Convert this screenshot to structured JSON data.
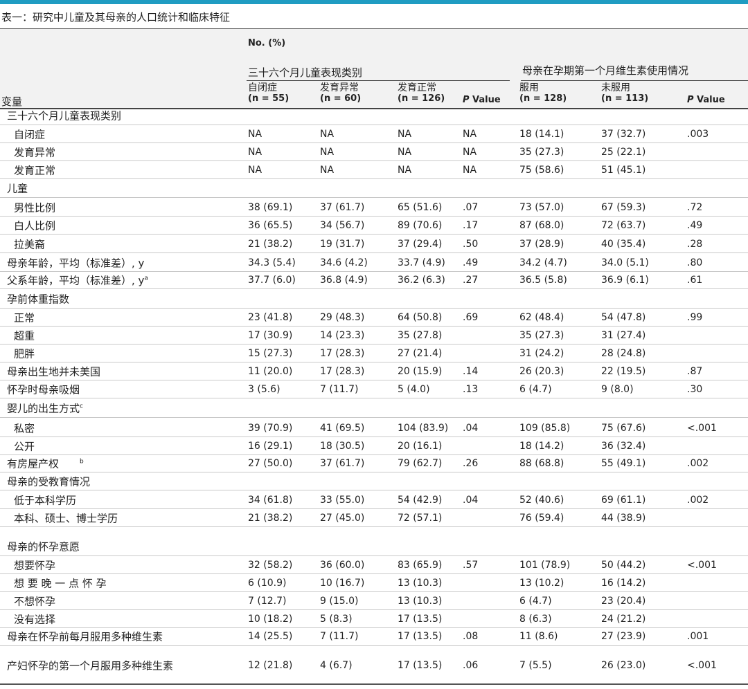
{
  "caption": "表一：研究中儿童及其母亲的人口统计和临床特征",
  "header": {
    "no_pct": "No. (%)",
    "group1": "三十六个月儿童表现类别",
    "group2": "母亲在孕期第一个月维生素使用情况",
    "variable": "变量",
    "columns": [
      {
        "name": "自闭症",
        "n": "(n = 55)"
      },
      {
        "name": "发育异常",
        "n": "(n = 60)"
      },
      {
        "name": "发育正常",
        "n": "(n = 126)"
      },
      {
        "name": "",
        "n": "Value",
        "p": "P"
      },
      {
        "name": "服用",
        "n": "(n = 128)"
      },
      {
        "name": "未服用",
        "n": "(n = 113)"
      },
      {
        "name": "",
        "n": "Value",
        "p": "P"
      }
    ]
  },
  "rows": [
    {
      "label": "三十六个月儿童表现类别",
      "cells": []
    },
    {
      "label": "自闭症",
      "cells": [
        "NA",
        "NA",
        "NA",
        "NA",
        "18 (14.1)",
        "37 (32.7)",
        ".003"
      ]
    },
    {
      "label": "发育异常",
      "cells": [
        "NA",
        "NA",
        "NA",
        "NA",
        "35 (27.3)",
        "25 (22.1)",
        ""
      ]
    },
    {
      "label": "发育正常",
      "cells": [
        "NA",
        "NA",
        "NA",
        "NA",
        "75 (58.6)",
        "51 (45.1)",
        ""
      ]
    },
    {
      "label": "儿童",
      "cells": []
    },
    {
      "label": "男性比例",
      "cells": [
        "38 (69.1)",
        "37 (61.7)",
        "65 (51.6)",
        ".07",
        "73 (57.0)",
        "67 (59.3)",
        ".72"
      ]
    },
    {
      "label": "白人比例",
      "cells": [
        "36 (65.5)",
        "34 (56.7)",
        "89 (70.6)",
        ".17",
        "87 (68.0)",
        "72 (63.7)",
        ".49"
      ]
    },
    {
      "label": "拉美裔",
      "cells": [
        "21 (38.2)",
        "19 (31.7)",
        "37 (29.4)",
        ".50",
        "37 (28.9)",
        "40 (35.4)",
        ".28"
      ]
    },
    {
      "label": "母亲年龄，平均（标准差）, y",
      "cells": [
        "34.3 (5.4)",
        "34.6 (4.2)",
        "33.7 (4.9)",
        ".49",
        "34.2 (4.7)",
        "34.0 (5.1)",
        ".80"
      ]
    },
    {
      "label": "父系年龄，平均（标准差）, y",
      "sup": "a",
      "cells": [
        "37.7 (6.0)",
        "36.8 (4.9)",
        "36.2 (6.3)",
        ".27",
        "36.5 (5.8)",
        "36.9 (6.1)",
        ".61"
      ]
    },
    {
      "label": "孕前体重指数",
      "cells": []
    },
    {
      "label": "正常",
      "cells": [
        "23 (41.8)",
        "29 (48.3)",
        "64 (50.8)",
        ".69",
        "62 (48.4)",
        "54 (47.8)",
        ".99"
      ]
    },
    {
      "label": "超重",
      "cells": [
        "17 (30.9)",
        "14 (23.3)",
        "35 (27.8)",
        "",
        "35 (27.3)",
        "31 (27.4)",
        ""
      ]
    },
    {
      "label": "肥胖",
      "cells": [
        "15 (27.3)",
        "17 (28.3)",
        "27 (21.4)",
        "",
        "31 (24.2)",
        "28 (24.8)",
        ""
      ]
    },
    {
      "label": "母亲出生地并未美国",
      "cells": [
        "11 (20.0)",
        "17 (28.3)",
        "20 (15.9)",
        ".14",
        "26 (20.3)",
        "22 (19.5)",
        ".87"
      ]
    },
    {
      "label": "怀孕时母亲吸烟",
      "cells": [
        "3 (5.6)",
        "7 (11.7)",
        "5 (4.0)",
        ".13",
        "6 (4.7)",
        "9 (8.0)",
        ".30"
      ]
    },
    {
      "label": "婴儿的出生方式",
      "sup": "c",
      "cells": []
    },
    {
      "label": "私密",
      "cells": [
        "39 (70.9)",
        "41 (69.5)",
        "104 (83.9)",
        ".04",
        "109 (85.8)",
        "75 (67.6)",
        "<.001"
      ]
    },
    {
      "label": "公开",
      "cells": [
        "16 (29.1)",
        "18 (30.5)",
        "20 (16.1)",
        "",
        "18 (14.2)",
        "36 (32.4)",
        ""
      ]
    },
    {
      "label": "有房屋产权",
      "sup": "b",
      "cells": [
        "27 (50.0)",
        "37 (61.7)",
        "79 (62.7)",
        ".26",
        "88 (68.8)",
        "55 (49.1)",
        ".002"
      ]
    },
    {
      "label": "母亲的受教育情况",
      "cells": []
    },
    {
      "label": "低于本科学历",
      "cells": [
        "34 (61.8)",
        "33 (55.0)",
        "54 (42.9)",
        ".04",
        "52 (40.6)",
        "69 (61.1)",
        ".002"
      ]
    },
    {
      "label": "本科、硕士、博士学历",
      "cells": [
        "21 (38.2)",
        "27 (45.0)",
        "72 (57.1)",
        "",
        "76 (59.4)",
        "44 (38.9)",
        ""
      ]
    },
    {
      "label": "母亲的怀孕意愿",
      "cells": []
    },
    {
      "label": "想要怀孕",
      "cells": [
        "32 (58.2)",
        "36 (60.0)",
        "83 (65.9)",
        ".57",
        "101 (78.9)",
        "50 (44.2)",
        "<.001"
      ]
    },
    {
      "label": "想 要 晚 一 点 怀 孕",
      "cells": [
        "6 (10.9)",
        "10 (16.7)",
        "13 (10.3)",
        "",
        "13 (10.2)",
        "16 (14.2)",
        ""
      ]
    },
    {
      "label": "不想怀孕",
      "cells": [
        "7 (12.7)",
        "9 (15.0)",
        "13 (10.3)",
        "",
        "6 (4.7)",
        "23 (20.4)",
        ""
      ]
    },
    {
      "label": "没有选择",
      "cells": [
        "10 (18.2)",
        "5 (8.3)",
        "17 (13.5)",
        "",
        "8 (6.3)",
        "24 (21.2)",
        ""
      ]
    },
    {
      "label": "母亲在怀孕前每月服用多种维生素",
      "cells": [
        "14 (25.5)",
        "7 (11.7)",
        "17 (13.5)",
        ".08",
        "11 (8.6)",
        "27 (23.9)",
        ".001"
      ]
    },
    {
      "label": "产妇怀孕的第一个月服用多种维生素",
      "cells": [
        "12 (21.8)",
        "4 (6.7)",
        "17 (13.5)",
        ".06",
        "7 (5.5)",
        "26 (23.0)",
        "<.001"
      ]
    }
  ],
  "colors": {
    "accent": "#1f9cc2",
    "header_bg": "#f2f2f2",
    "rule": "#c8c8c8"
  }
}
